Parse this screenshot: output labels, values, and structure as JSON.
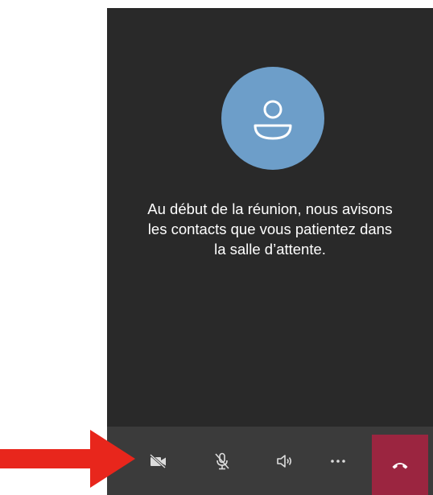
{
  "waiting_room": {
    "message": "Au début de la réunion, nous avisons\nles contacts que vous patientez dans\nla salle d’attente.",
    "avatar_icon": "user-icon",
    "avatar_color": "#6d9ec9"
  },
  "toolbar": {
    "buttons": [
      {
        "icon": "camera-off-icon"
      },
      {
        "icon": "mic-off-icon"
      },
      {
        "icon": "speaker-icon"
      },
      {
        "icon": "more-icon"
      },
      {
        "icon": "hang-up-icon",
        "color": "#9b2540"
      }
    ]
  },
  "annotation": {
    "icon": "red-arrow-icon",
    "color": "#e8261c"
  }
}
